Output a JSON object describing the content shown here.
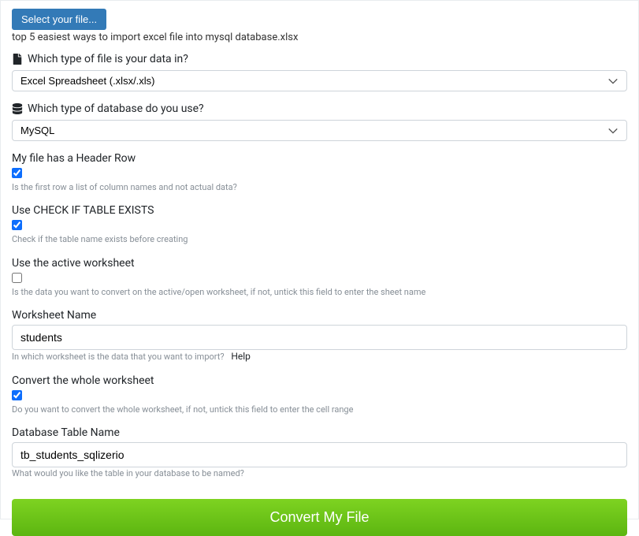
{
  "select_file_label": "Select your file...",
  "filename": "top 5 easiest ways to import excel file into mysql database.xlsx",
  "file_type": {
    "label": "Which type of file is your data in?",
    "value": "Excel Spreadsheet (.xlsx/.xls)"
  },
  "db_type": {
    "label": "Which type of database do you use?",
    "value": "MySQL"
  },
  "header_row": {
    "label": "My file has a Header Row",
    "checked": true,
    "help": "Is the first row a list of column names and not actual data?"
  },
  "check_table": {
    "label": "Use CHECK IF TABLE EXISTS",
    "checked": true,
    "help": "Check if the table name exists before creating"
  },
  "active_worksheet": {
    "label": "Use the active worksheet",
    "checked": false,
    "help": "Is the data you want to convert on the active/open worksheet, if not, untick this field to enter the sheet name"
  },
  "worksheet_name": {
    "label": "Worksheet Name",
    "value": "students",
    "help": "In which worksheet is the data that you want to import?",
    "help_link": "Help"
  },
  "whole_worksheet": {
    "label": "Convert the whole worksheet",
    "checked": true,
    "help": "Do you want to convert the whole worksheet, if not, untick this field to enter the cell range"
  },
  "table_name": {
    "label": "Database Table Name",
    "value": "tb_students_sqlizerio",
    "help": "What would you like the table in your database to be named?"
  },
  "convert_label": "Convert My File"
}
